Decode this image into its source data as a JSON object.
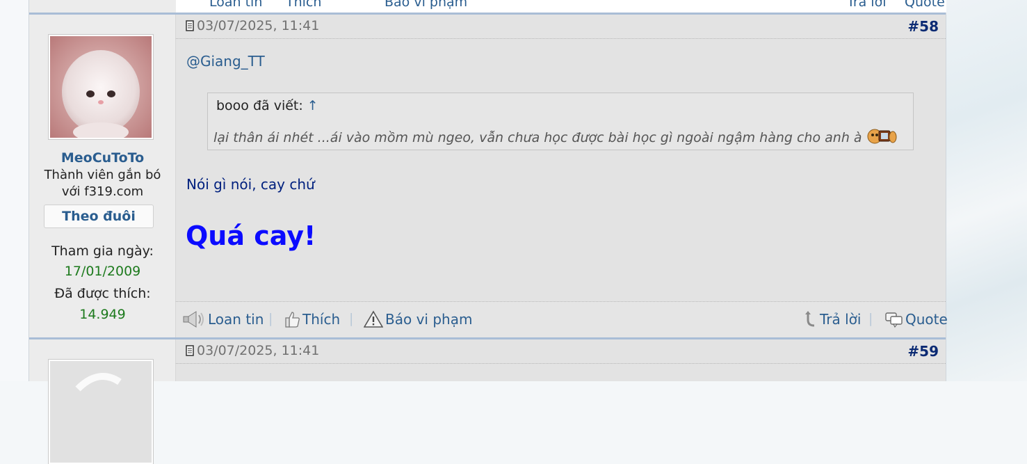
{
  "prev_toolbar": {
    "labels": [
      "Loan tin",
      "Thích",
      "Báo vi phạm",
      "Trả lời",
      "Quote"
    ]
  },
  "post58": {
    "date": "03/07/2025, 11:41",
    "number": "#58",
    "user": {
      "name": "MeoCuToTo",
      "title_line1": "Thành viên gắn bó",
      "title_line2": "với f319.com",
      "follow_label": "Theo đuôi",
      "joined_label": "Tham gia ngày:",
      "joined_value": "17/01/2009",
      "likes_label": "Đã được thích:",
      "likes_value": "14.949"
    },
    "mention": "@Giang_TT",
    "quote": {
      "author_line": "booo đã viết:",
      "arrow": "↑",
      "text": "lại thân ái nhét ...ái vào mồm mù ngeo, vẫn chưa học được bài học gì ngoài ngậm hàng cho anh à"
    },
    "line1": "Nói gì nói, cay chứ",
    "big_text": "Quá cay!",
    "footer": {
      "report": "Loan tin",
      "like": "Thích",
      "abuse": "Báo vi phạm",
      "reply": "Trả lời",
      "quote": "Quote",
      "separator": "|"
    }
  },
  "post59": {
    "date": "03/07/2025, 11:41",
    "number": "#59"
  }
}
